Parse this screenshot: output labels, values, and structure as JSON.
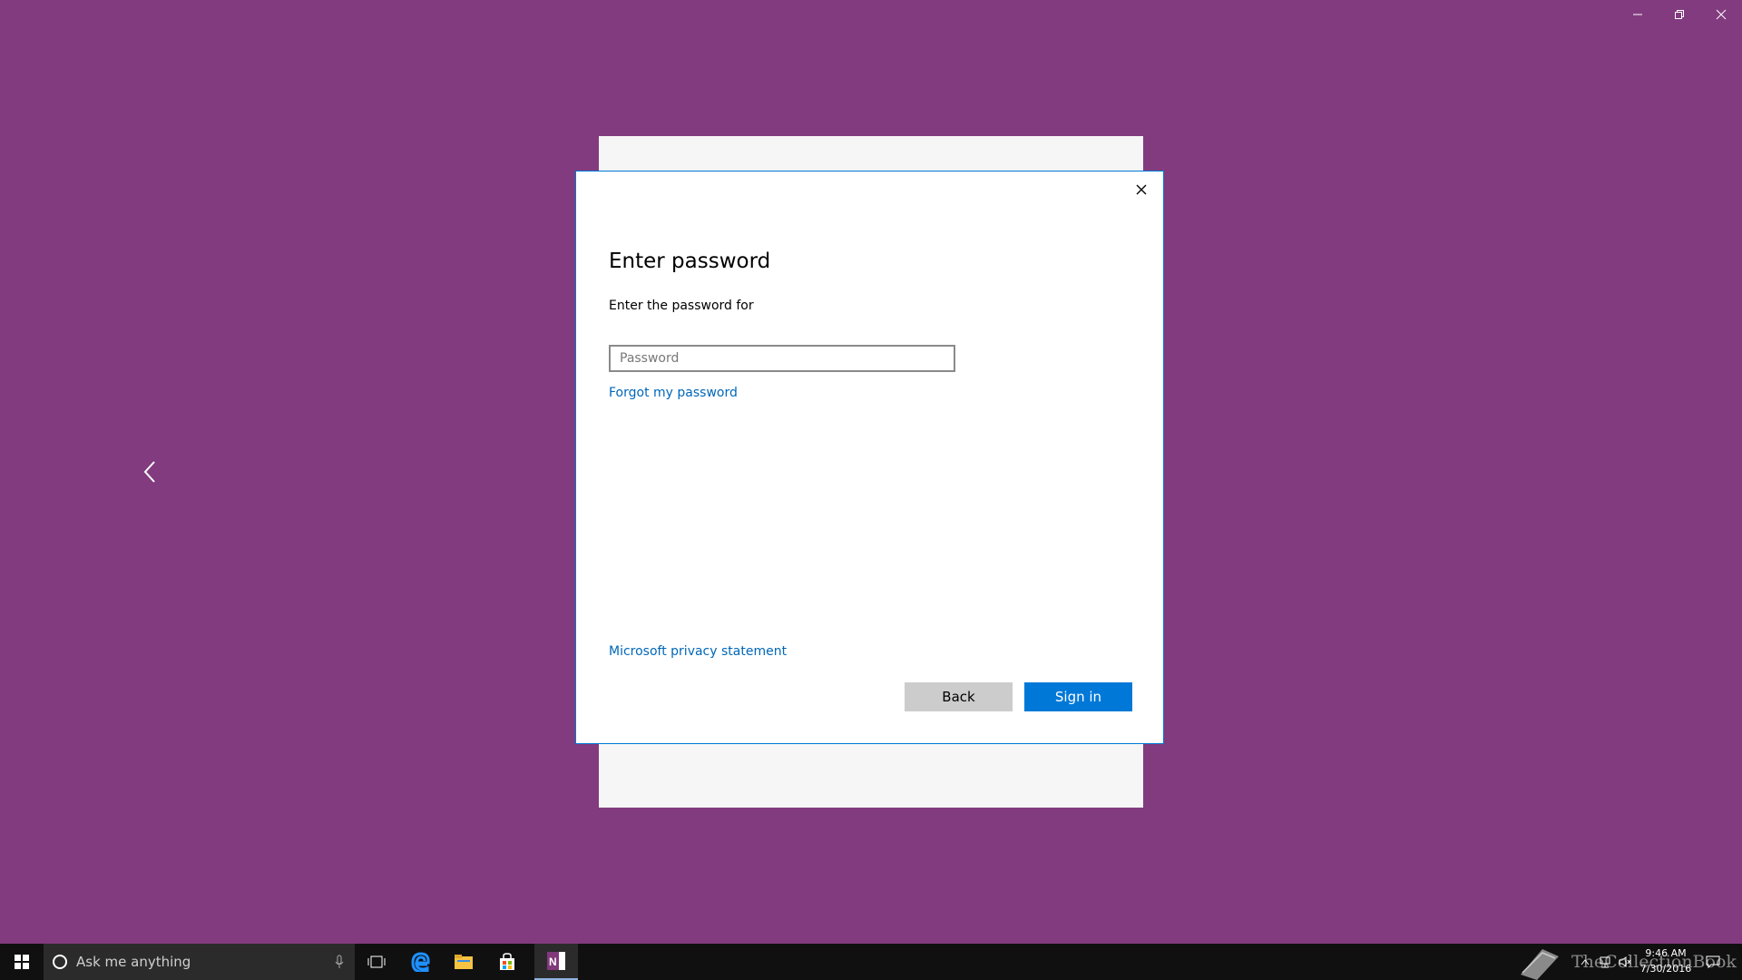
{
  "window_controls": {
    "minimize_icon": "minimize-icon",
    "restore_icon": "restore-icon",
    "close_icon": "close-icon"
  },
  "dialog": {
    "title": "Enter password",
    "subtitle": "Enter the password for",
    "password_placeholder": "Password",
    "forgot_link": "Forgot my password",
    "privacy_link": "Microsoft privacy statement",
    "back_label": "Back",
    "signin_label": "Sign in",
    "accent_color": "#0078d7"
  },
  "taskbar": {
    "search_placeholder": "Ask me anything",
    "watermark": "TheCollectionBook",
    "clock_time": "9:46 AM",
    "clock_date": "7/30/2016"
  },
  "colors": {
    "background": "#823b7e",
    "link": "#0067b8",
    "taskbar": "#101010"
  }
}
